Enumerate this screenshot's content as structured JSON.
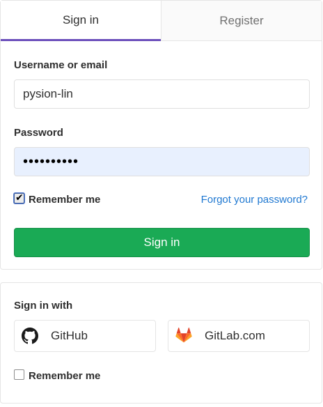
{
  "tabs": {
    "signin": "Sign in",
    "register": "Register"
  },
  "form": {
    "username_label": "Username or email",
    "username_value": "pysion-lin",
    "password_label": "Password",
    "password_mask": "••••••••••",
    "remember_label": "Remember me",
    "forgot_label": "Forgot your password?",
    "submit_label": "Sign in"
  },
  "oauth": {
    "heading": "Sign in with",
    "providers": [
      "GitHub",
      "GitLab.com"
    ],
    "remember_label": "Remember me"
  },
  "colors": {
    "accent": "#6b4fbb",
    "submit": "#1aaa55",
    "link": "#1f78d1",
    "gitlab_orange": "#e24329"
  }
}
